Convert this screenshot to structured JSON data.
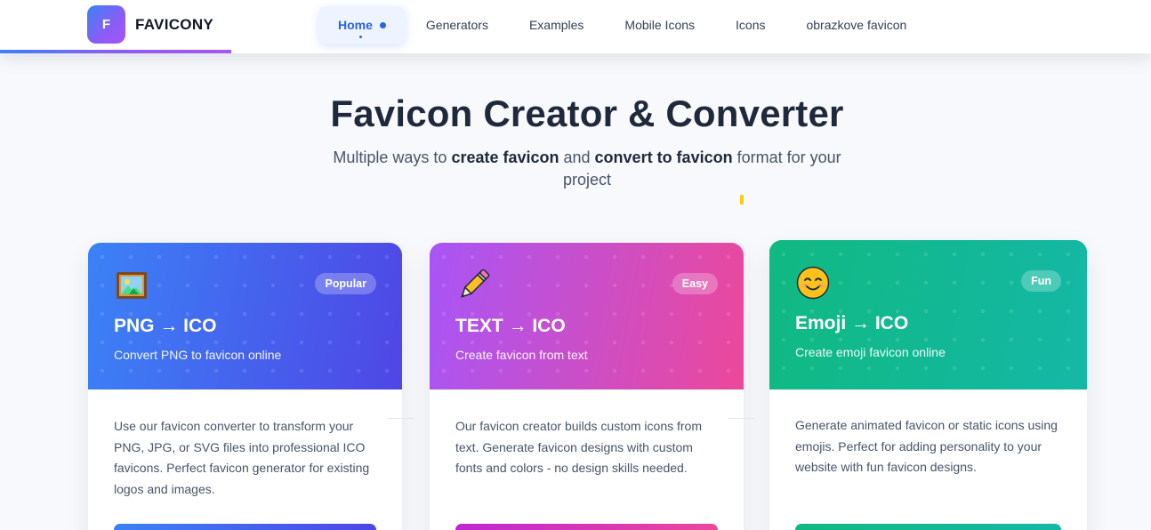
{
  "brand": {
    "logo_letter": "F",
    "name": "FAVICONY"
  },
  "nav": {
    "items": [
      {
        "label": "Home",
        "active": true
      },
      {
        "label": "Generators"
      },
      {
        "label": "Examples"
      },
      {
        "label": "Mobile Icons"
      },
      {
        "label": "Icons"
      },
      {
        "label": "obrazkove favicon"
      }
    ]
  },
  "hero": {
    "title": "Favicon Creator & Converter",
    "sub_before": "Multiple ways to ",
    "sub_bold1": "create favicon",
    "sub_mid": " and ",
    "sub_bold2": "convert to favicon",
    "sub_after": " format for your project"
  },
  "cards": [
    {
      "icon": "framed-picture-icon",
      "badge": "Popular",
      "title": "PNG → ICO",
      "tagline": "Convert PNG to favicon online",
      "description": "Use our favicon converter to transform your PNG, JPG, or SVG files into professional ICO favicons. Perfect favicon generator for existing logos and images.",
      "accent": "#3b82f6"
    },
    {
      "icon": "pencil-icon",
      "badge": "Easy",
      "title": "TEXT → ICO",
      "tagline": "Create favicon from text",
      "description": "Our favicon creator builds custom icons from text. Generate favicon designs with custom fonts and colors - no design skills needed.",
      "accent": "#d946ef"
    },
    {
      "icon": "smiling-face-icon",
      "badge": "Fun",
      "title": "Emoji → ICO",
      "tagline": "Create emoji favicon online",
      "description": "Generate animated favicon or static icons using emojis. Perfect for adding personality to your website with fun favicon designs.",
      "accent": "#10b981"
    }
  ]
}
